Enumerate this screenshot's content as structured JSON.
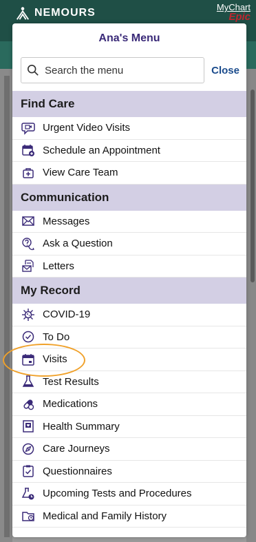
{
  "background": {
    "org_name": "NEMOURS",
    "app_name": "MyChart",
    "brand_small": "Epic"
  },
  "menu": {
    "title": "Ana's Menu",
    "search_placeholder": "Search the menu",
    "close_label": "Close",
    "sections": [
      {
        "heading": "Find Care",
        "items": [
          {
            "label": "Urgent Video Visits",
            "icon": "video-chat-icon"
          },
          {
            "label": "Schedule an Appointment",
            "icon": "calendar-add-icon"
          },
          {
            "label": "View Care Team",
            "icon": "care-team-icon"
          }
        ]
      },
      {
        "heading": "Communication",
        "items": [
          {
            "label": "Messages",
            "icon": "envelope-icon"
          },
          {
            "label": "Ask a Question",
            "icon": "question-bubble-icon"
          },
          {
            "label": "Letters",
            "icon": "letters-icon"
          }
        ]
      },
      {
        "heading": "My Record",
        "items": [
          {
            "label": "COVID-19",
            "icon": "virus-icon"
          },
          {
            "label": "To Do",
            "icon": "clock-check-icon"
          },
          {
            "label": "Visits",
            "icon": "calendar-icon"
          },
          {
            "label": "Test Results",
            "icon": "flask-icon"
          },
          {
            "label": "Medications",
            "icon": "pill-icon"
          },
          {
            "label": "Health Summary",
            "icon": "health-summary-icon"
          },
          {
            "label": "Care Journeys",
            "icon": "compass-icon"
          },
          {
            "label": "Questionnaires",
            "icon": "clipboard-check-icon"
          },
          {
            "label": "Upcoming Tests and Procedures",
            "icon": "flask-clock-icon"
          },
          {
            "label": "Medical and Family History",
            "icon": "folder-clock-icon"
          }
        ]
      }
    ]
  },
  "colors": {
    "accent": "#3a2a78",
    "section_bg": "#d3cfe4",
    "link": "#1a4b8c",
    "highlight": "#f0a12a"
  }
}
